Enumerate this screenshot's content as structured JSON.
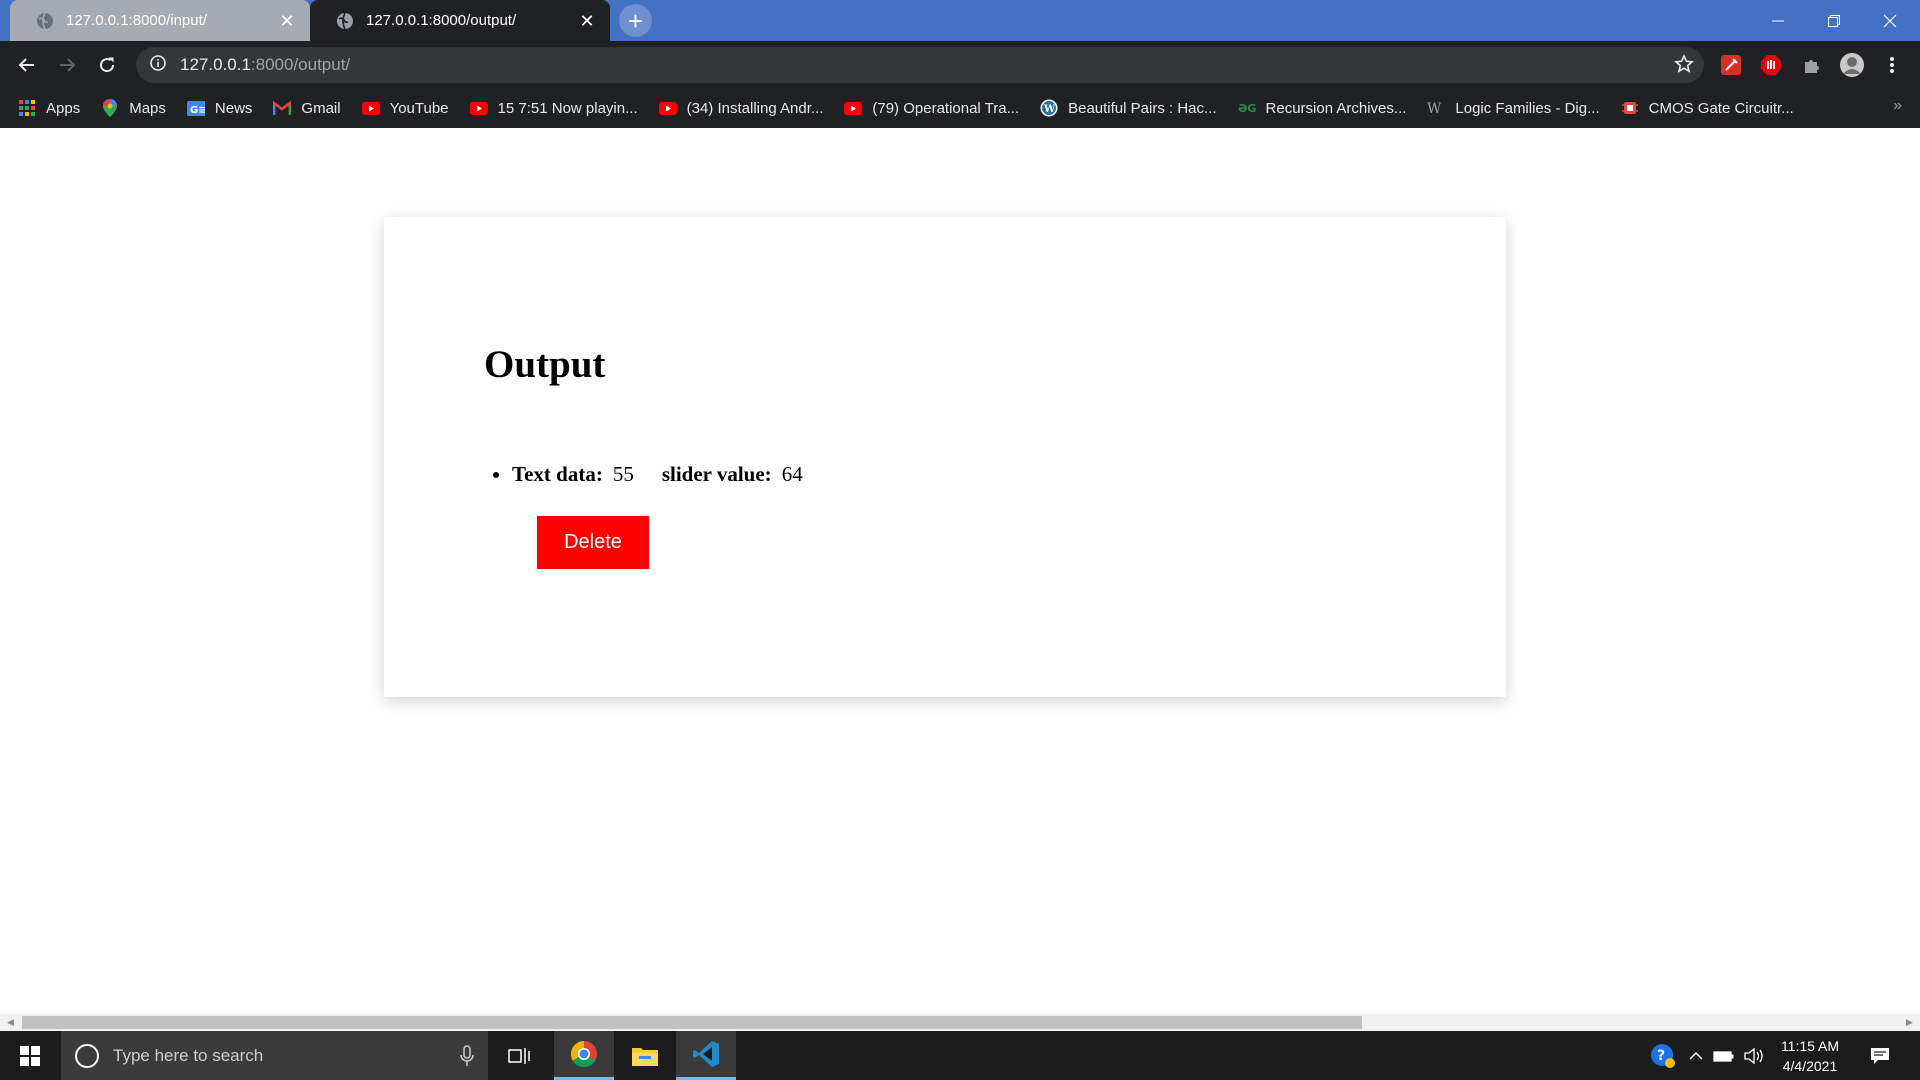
{
  "browser": {
    "tabs": [
      {
        "title": "127.0.0.1:8000/input/",
        "active": false
      },
      {
        "title": "127.0.0.1:8000/output/",
        "active": true
      }
    ],
    "new_tab_icon": "plus-icon",
    "address": {
      "host": "127.0.0.1",
      "path": ":8000/output/"
    },
    "bookmarks": [
      {
        "label": "Apps",
        "icon": "apps-grid-icon"
      },
      {
        "label": "Maps",
        "icon": "maps-pin-icon"
      },
      {
        "label": "News",
        "icon": "google-news-icon"
      },
      {
        "label": "Gmail",
        "icon": "gmail-icon"
      },
      {
        "label": "YouTube",
        "icon": "youtube-icon"
      },
      {
        "label": "15 7:51 Now playin...",
        "icon": "youtube-icon"
      },
      {
        "label": "(34) Installing Andr...",
        "icon": "youtube-icon"
      },
      {
        "label": "(79) Operational Tra...",
        "icon": "youtube-icon"
      },
      {
        "label": "Beautiful Pairs : Hac...",
        "icon": "wordpress-icon"
      },
      {
        "label": "Recursion Archives...",
        "icon": "geeksforgeeks-icon"
      },
      {
        "label": "Logic Families - Dig...",
        "icon": "w-logo-icon"
      },
      {
        "label": "CMOS Gate Circuitr...",
        "icon": "chip-icon"
      }
    ],
    "colors": {
      "tabstrip": "#4471c4",
      "toolbar": "#202124"
    }
  },
  "page": {
    "heading": "Output",
    "items": [
      {
        "text_label": "Text data:",
        "text_value": "55",
        "slider_label": "slider value:",
        "slider_value": "64"
      }
    ],
    "delete_label": "Delete",
    "delete_color": "#ff0000"
  },
  "taskbar": {
    "search_placeholder": "Type here to search",
    "time": "11:15 AM",
    "date": "4/4/2021",
    "apps": [
      "task-view-icon",
      "chrome-icon",
      "file-explorer-icon",
      "vscode-icon"
    ]
  }
}
